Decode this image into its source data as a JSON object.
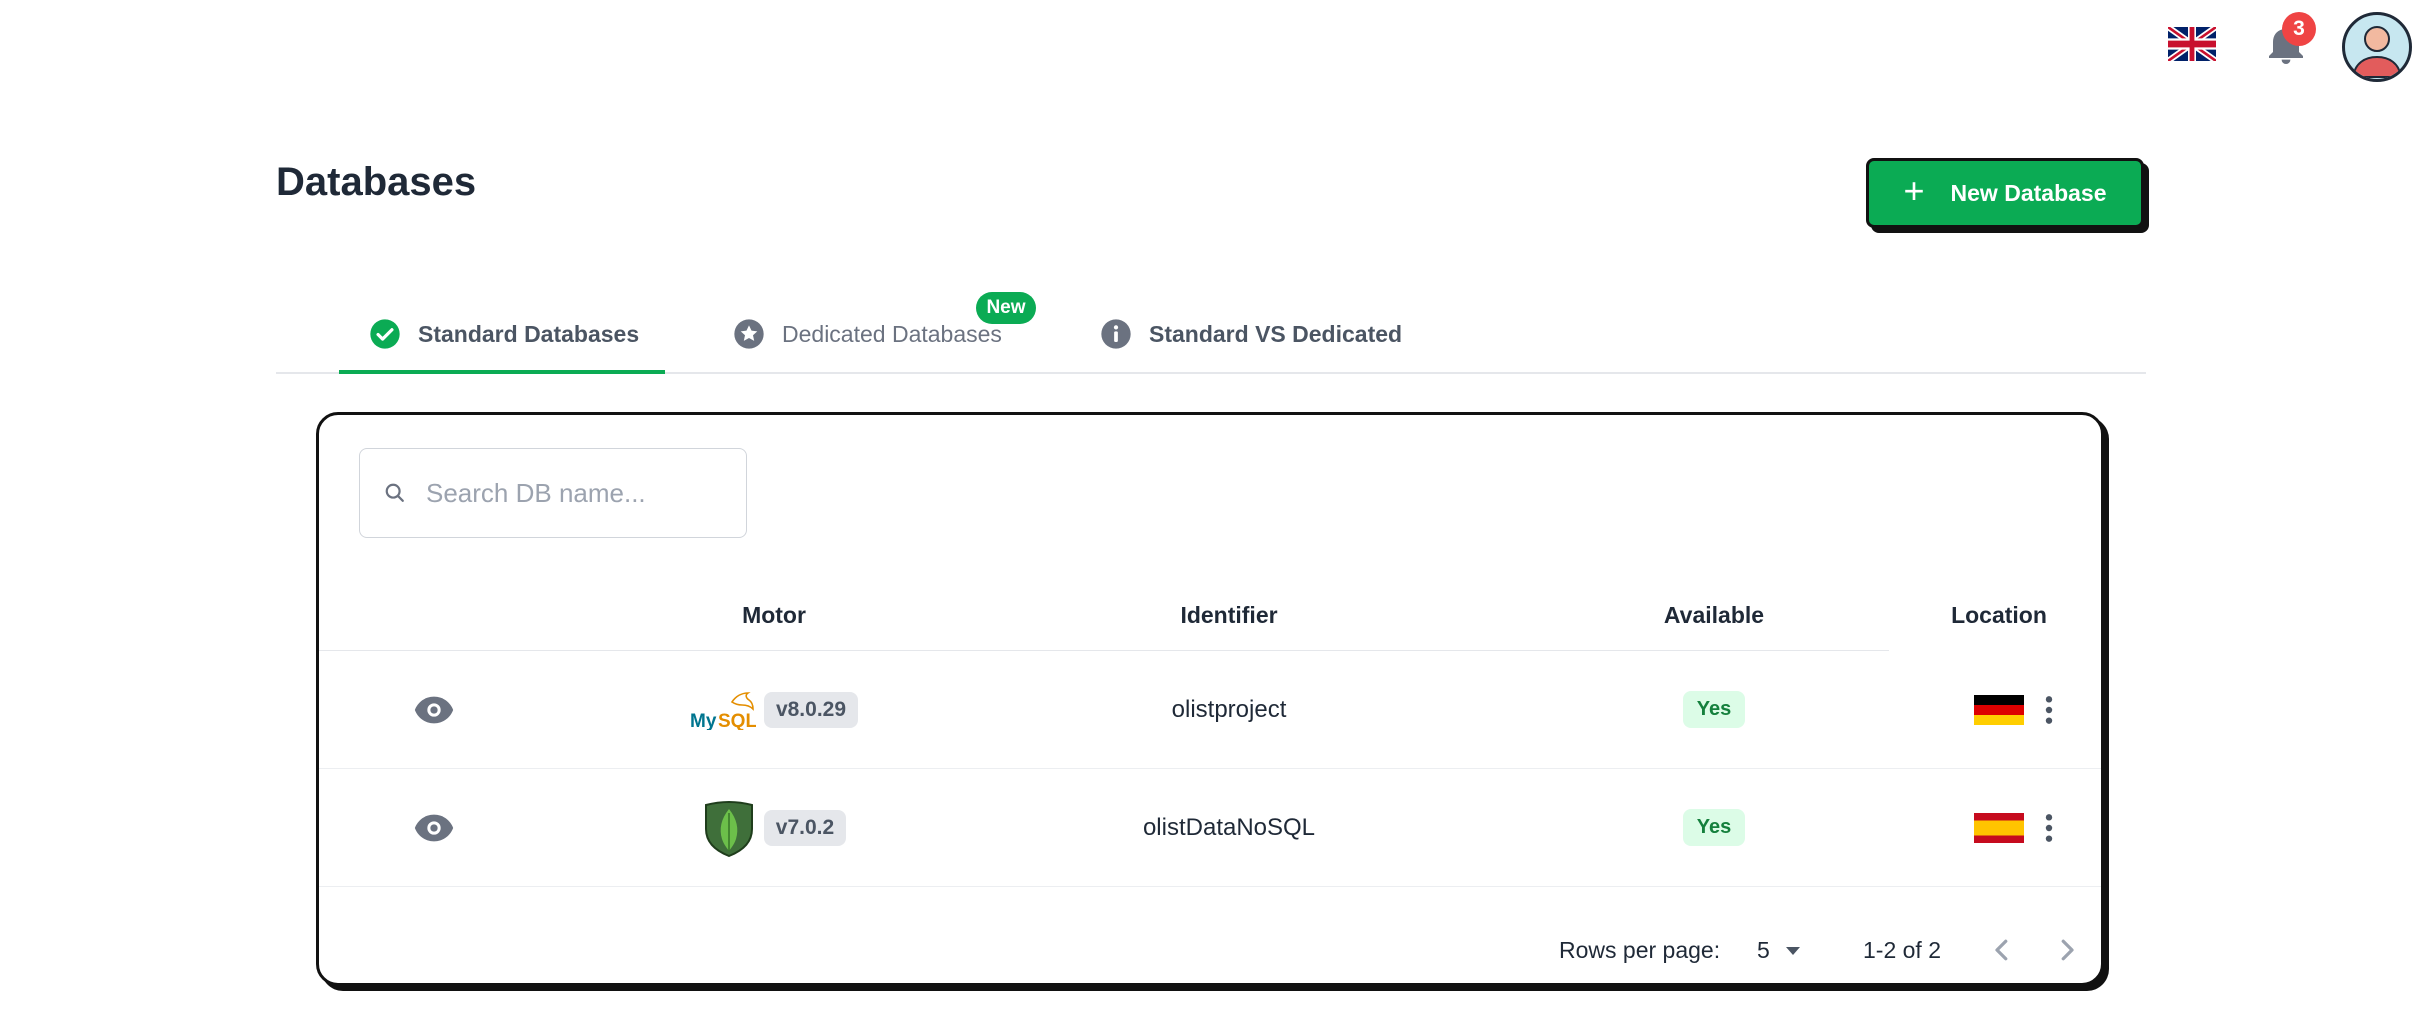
{
  "topbar": {
    "language_flag": "uk-flag",
    "notifications_count": "3"
  },
  "header": {
    "title": "Databases",
    "new_button_label": "New Database",
    "new_button_icon": "plus-icon"
  },
  "tabs": [
    {
      "label": "Standard Databases",
      "icon": "check-circle-icon",
      "active": true
    },
    {
      "label": "Dedicated Databases",
      "icon": "star-circle-icon",
      "badge": "New"
    },
    {
      "label": "Standard VS Dedicated",
      "icon": "info-circle-icon"
    }
  ],
  "search": {
    "placeholder": "Search DB name...",
    "value": ""
  },
  "table": {
    "columns": [
      "Motor",
      "Identifier",
      "Available",
      "Location"
    ],
    "rows": [
      {
        "motor": "MySQL",
        "motor_logo": "mysql-logo",
        "version": "v8.0.29",
        "identifier": "olistproject",
        "available": "Yes",
        "location": "germany-flag"
      },
      {
        "motor": "MongoDB",
        "motor_logo": "mongodb-logo",
        "version": "v7.0.2",
        "identifier": "olistDataNoSQL",
        "available": "Yes",
        "location": "spain-flag"
      }
    ]
  },
  "pagination": {
    "rows_per_page_label": "Rows per page:",
    "rows_per_page": "5",
    "range": "1-2 of 2"
  },
  "colors": {
    "accent": "#0bab54",
    "badge_red": "#ef4444",
    "yes_bg": "#dcfce7",
    "yes_text": "#15803d"
  }
}
